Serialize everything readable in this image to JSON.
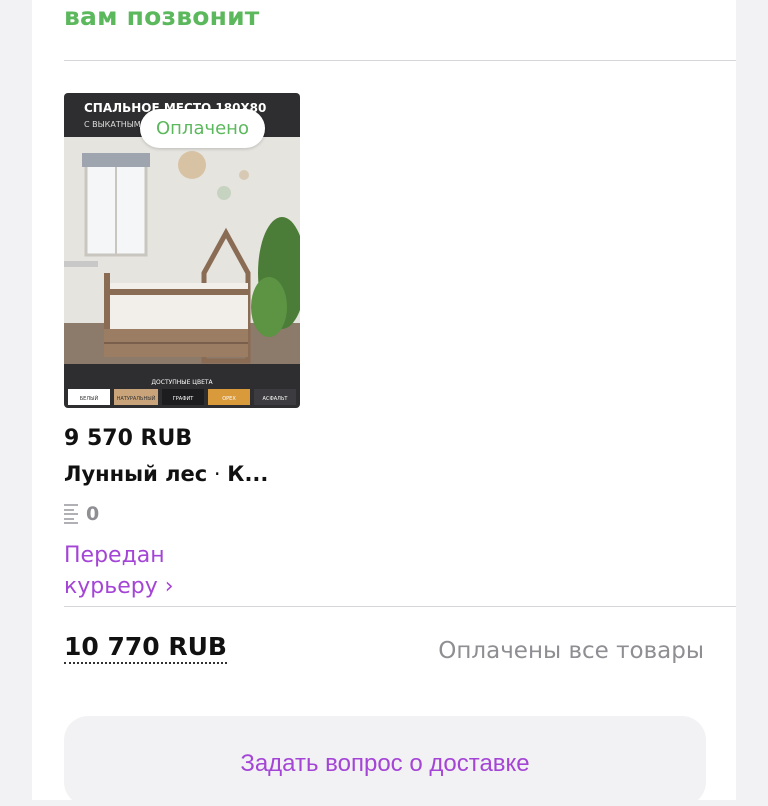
{
  "header": {
    "callback_text": "вам позвонит"
  },
  "product": {
    "image_alt": "Кровать-домик Лунный лес",
    "image_banner_title": "СПАЛЬНОЕ МЕСТО 180Х80",
    "image_banner_subtitle": "С ВЫКАТНЫМИ",
    "image_colors_title": "ДОСТУПНЫЕ ЦВЕТА",
    "image_colors": [
      "БЕЛЫЙ",
      "НАТУРАЛЬНЫЙ",
      "ГРАФИТ",
      "ОРЕХ",
      "АСФАЛЬТ"
    ],
    "paid_badge": "Оплачено",
    "price": "9 570 RUB",
    "name": "Лунный лес",
    "name_separator": " · ",
    "name_rest": "К...",
    "quantity": "0",
    "status": "Передан курьеру ›"
  },
  "order": {
    "total": "10 770 RUB",
    "payment_status": "Оплачены все товары",
    "ask_delivery_button": "Задать вопрос о доставке"
  },
  "colors": {
    "accent_green": "#5cb85c",
    "accent_purple": "#a445d6",
    "muted_gray": "#8e8e93"
  }
}
